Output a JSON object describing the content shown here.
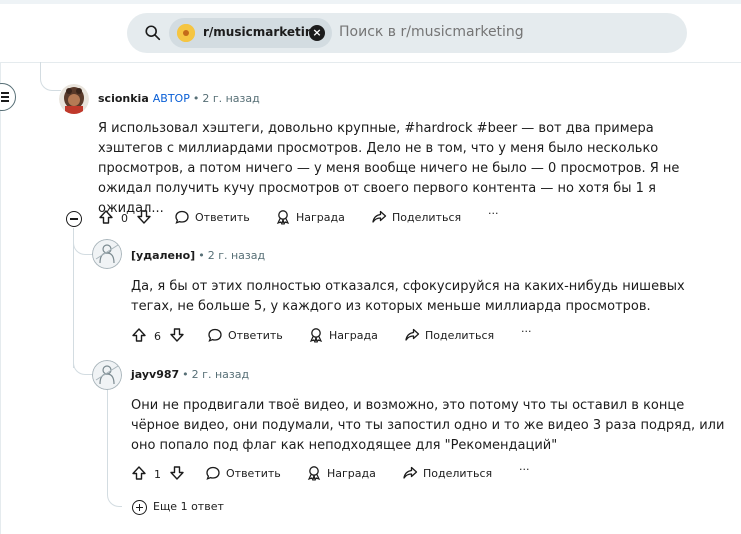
{
  "search": {
    "subreddit_chip": "r/musicmarketing",
    "placeholder": "Поиск в r/musicmarketing"
  },
  "comments": [
    {
      "author": "scionkia",
      "op_badge": "АВТОР",
      "separator": "•",
      "time": "2 г. назад",
      "body": "Я использовал хэштеги, довольно крупные, #hardrock #beer — вот два примера хэштегов с миллиардами просмотров. Дело не в том, что у меня было несколько просмотров, а потом ничего — у меня вообще ничего не было — 0 просмотров. Я не ожидал получить кучу просмотров от своего первого контента — но хотя бы 1 я ожидал...",
      "score": "0",
      "reply_label": "Ответить",
      "award_label": "Награда",
      "share_label": "Поделиться",
      "more_label": "···"
    },
    {
      "author": "[удалено]",
      "separator": "•",
      "time": "2 г. назад",
      "body": "Да, я бы от этих полностью отказался, сфокусируйся на каких-нибудь нишевых тегах, не больше 5, у каждого из которых меньше миллиарда просмотров.",
      "score": "6",
      "reply_label": "Ответить",
      "award_label": "Награда",
      "share_label": "Поделиться",
      "more_label": "···"
    },
    {
      "author": "jayv987",
      "separator": "•",
      "time": "2 г. назад",
      "body": "Они не продвигали твоё видео, и возможно, это потому что ты оставил в конце чёрное видео, они подумали, что ты запостил одно и то же видео 3 раза подряд, или оно попало под флаг как неподходящее для \"Рекомендаций\"",
      "score": "1",
      "reply_label": "Ответить",
      "award_label": "Награда",
      "share_label": "Поделиться",
      "more_label": "···"
    }
  ],
  "more_replies": "Еще 1 ответ",
  "colors": {
    "accent": "#0a5fd6",
    "muted": "#576f76",
    "thread": "#d3dce1"
  }
}
